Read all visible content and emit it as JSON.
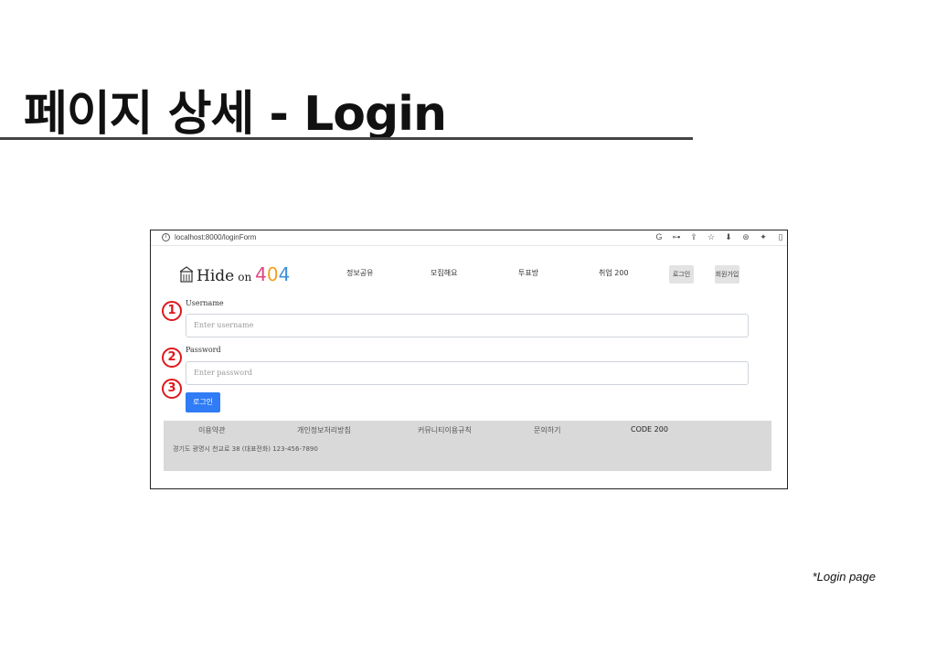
{
  "slide": {
    "title": "페이지 상세  - Login",
    "caption": "*Login page"
  },
  "browser": {
    "url": "localhost:8000/loginForm",
    "toolbar_icons": [
      "G",
      "⊶",
      "⇪",
      "☆",
      "⬇",
      "⊛",
      "✦",
      "▯"
    ]
  },
  "site": {
    "logo": {
      "prefix": "Hide",
      "on": "on",
      "num": "404"
    },
    "nav": [
      "정보공유",
      "모집해요",
      "투표방",
      "취업 200"
    ],
    "login_button": "로그인",
    "signup_button": "회원가입"
  },
  "form": {
    "username_label": "Username",
    "username_placeholder": "Enter username",
    "password_label": "Password",
    "password_placeholder": "Enter password",
    "submit_label": "로그인"
  },
  "footer": {
    "links": [
      "이용약관",
      "개인정보처리방침",
      "커뮤니티이용규칙",
      "문의하기",
      "CODE 200"
    ],
    "address": "경기도 광명시 천교로 38 (대표전화) 123-456-7890"
  },
  "markers": [
    "1",
    "2",
    "3"
  ],
  "colors": {
    "marker": "#e0181c",
    "primary_button": "#2f7cf6",
    "footer_bg": "#d9d9d9"
  }
}
